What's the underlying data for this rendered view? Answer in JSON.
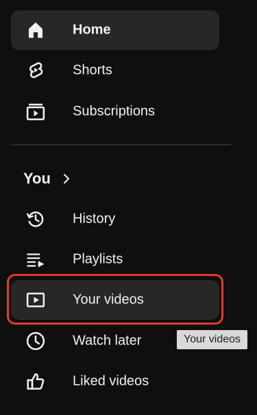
{
  "nav": {
    "home": {
      "label": "Home",
      "icon": "home-icon"
    },
    "shorts": {
      "label": "Shorts",
      "icon": "shorts-icon"
    },
    "subscriptions": {
      "label": "Subscriptions",
      "icon": "subscriptions-icon"
    }
  },
  "you_section": {
    "title": "You",
    "chevron_icon": "chevron-right-icon",
    "items": [
      {
        "label": "History",
        "icon": "history-icon"
      },
      {
        "label": "Playlists",
        "icon": "playlists-icon"
      },
      {
        "label": "Your videos",
        "icon": "your-videos-icon"
      },
      {
        "label": "Watch later",
        "icon": "watch-later-icon"
      },
      {
        "label": "Liked videos",
        "icon": "liked-videos-icon"
      }
    ]
  },
  "tooltip": {
    "text": "Your videos"
  },
  "colors": {
    "background": "#0f0f0f",
    "active_item": "#272727",
    "highlight_border": "#e23b2a",
    "tooltip_bg": "#d9d9d9",
    "text": "#f1f1f1"
  }
}
